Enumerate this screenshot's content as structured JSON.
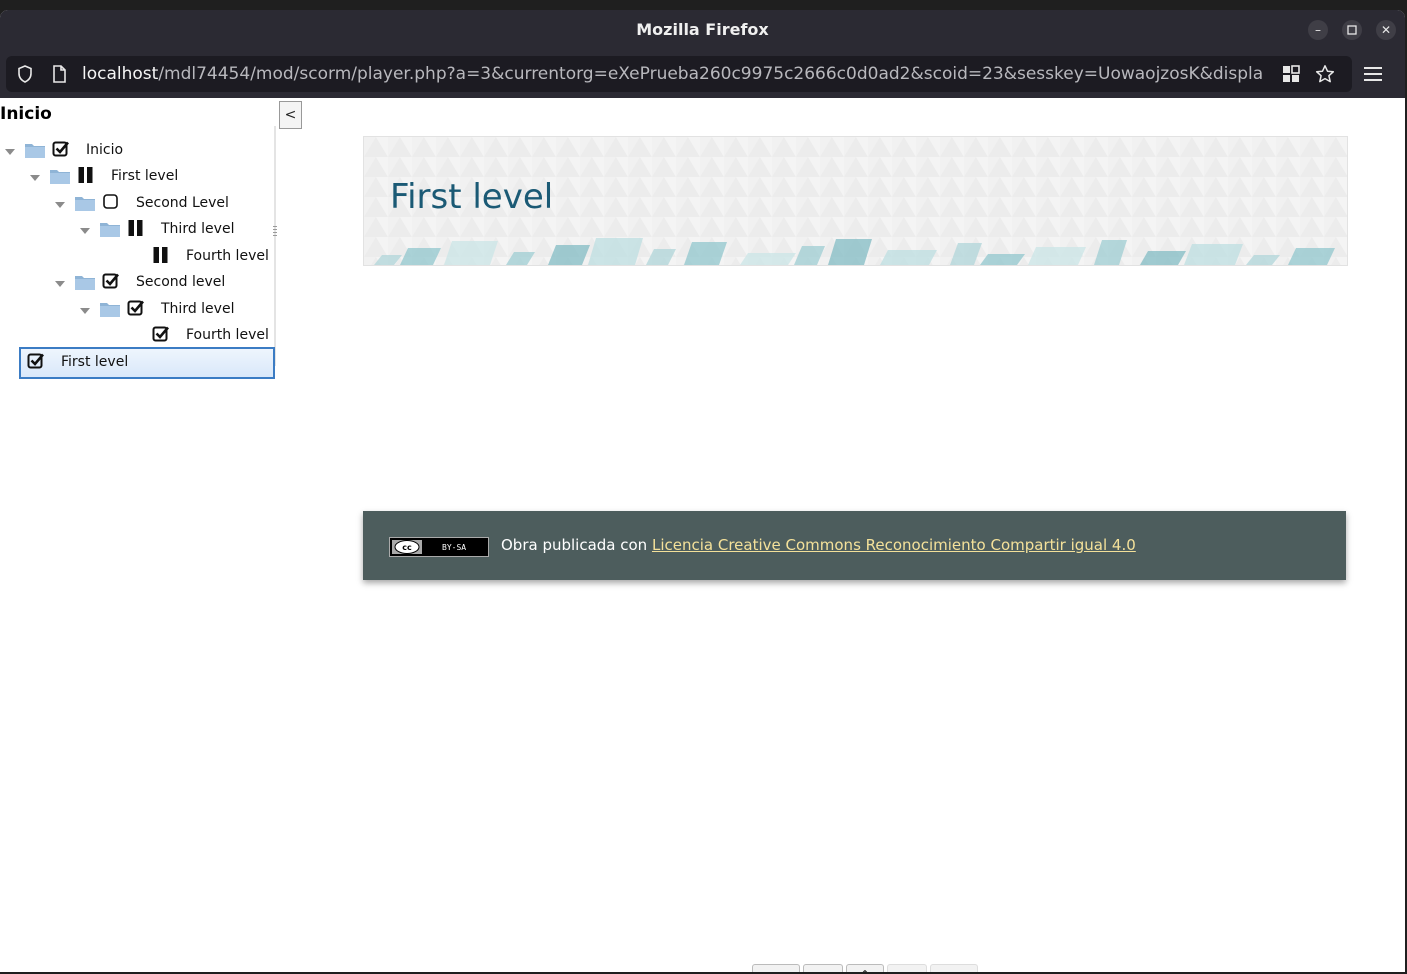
{
  "window": {
    "title": "Mozilla Firefox"
  },
  "url": {
    "host": "localhost",
    "path": "/mdl74454/mod/scorm/player.php?a=3&currentorg=eXePrueba260c9975c2666c0d0ad2&scoid=23&sesskey=UowaojzosK&displa"
  },
  "toc": {
    "heading": "Inicio",
    "toggle_label": "<",
    "items": [
      {
        "label": "Inicio",
        "status": "completed"
      },
      {
        "label": "First level",
        "status": "incomplete"
      },
      {
        "label": "Second Level",
        "status": "notattempted"
      },
      {
        "label": "Third level",
        "status": "incomplete"
      },
      {
        "label": "Fourth level",
        "status": "incomplete"
      },
      {
        "label": "Second level",
        "status": "completed"
      },
      {
        "label": "Third level",
        "status": "completed"
      },
      {
        "label": "Fourth level",
        "status": "completed"
      },
      {
        "label": "First level",
        "status": "completed",
        "selected": true
      }
    ]
  },
  "page": {
    "title": "First level",
    "footer_prefix": "Obra publicada con ",
    "footer_link": "Licencia Creative Commons Reconocimiento Compartir igual 4.0",
    "cc_badge_text": "BY-SA"
  },
  "nav_buttons": [
    {
      "label": "<<",
      "enabled": true
    },
    {
      "label": "<",
      "enabled": true
    },
    {
      "label": "^",
      "enabled": true
    },
    {
      "label": ">",
      "enabled": false
    },
    {
      "label": ">>",
      "enabled": false
    }
  ],
  "colors": {
    "title_color": "#1b5a75",
    "footer_bg": "#4d5d5d",
    "link_color": "#f4e19a",
    "selection_border": "#3b7cc4"
  }
}
